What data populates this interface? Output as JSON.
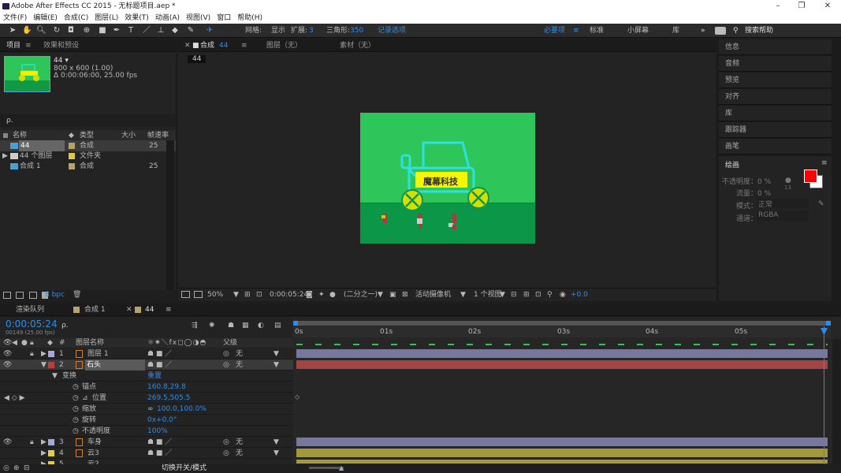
{
  "window": {
    "title": "Adobe After Effects CC 2015 - 无标题项目.aep *",
    "min": "–",
    "max": "❐",
    "close": "✕"
  },
  "menu": [
    "文件(F)",
    "编辑(E)",
    "合成(C)",
    "图层(L)",
    "效果(T)",
    "动画(A)",
    "视图(V)",
    "窗口",
    "帮助(H)"
  ],
  "toolbar": {
    "grid": "网格:",
    "show": "显示",
    "expand": "扩展:",
    "expand_val": "3",
    "triangles": "三角形:",
    "triangles_val": "350",
    "record": "记录选项",
    "workspaces": [
      "必要项",
      "标准",
      "小屏幕",
      "库"
    ],
    "more": "»",
    "search": "搜索帮助"
  },
  "project": {
    "tab": "项目",
    "tab_menu": "≡",
    "effects_tab": "效果和预设",
    "comp_name": "44 ▾",
    "comp_size": "800 x 600 (1.00)",
    "comp_dur": "Δ 0:00:06:00, 25.00 fps",
    "search_placeholder": "ρ.",
    "cols": [
      "名称",
      "类型",
      "大小",
      "帧速率"
    ],
    "items": [
      {
        "name": "44",
        "type": "合成",
        "size": "",
        "fps": "25",
        "color": "#b8a26b"
      },
      {
        "name": "44 个图层",
        "type": "文件夹",
        "size": "",
        "fps": "",
        "color": "#e0c74a"
      },
      {
        "name": "合成 1",
        "type": "合成",
        "size": "",
        "fps": "25",
        "color": "#b8a26b"
      }
    ],
    "bpc": "8 bpc"
  },
  "viewer": {
    "tabs": [
      "合成",
      "图层（无）",
      "素材（无）"
    ],
    "comp_tab_name": "44",
    "comp_label": "44",
    "zoom": "50%",
    "time": "0:00:05:24",
    "res": "(二分之一)",
    "camera": "活动摄像机",
    "views": "1 个视图",
    "exposure": "+0.0",
    "car_sign": "魔幕科技"
  },
  "right": {
    "panels": [
      "信息",
      "音频",
      "预览",
      "对齐",
      "库",
      "跟踪器",
      "画笔"
    ],
    "paint": {
      "title": "绘画",
      "opacity": "不透明度：0 %",
      "flow": "流量：0 %",
      "mode_label": "模式：",
      "mode": "正常",
      "channel_label": "通道：",
      "channel": "RGBA",
      "brush_size": "13",
      "fg": "#ff0000",
      "bg": "#ffffff"
    }
  },
  "timeline": {
    "tabs": [
      "渲染队列",
      "合成 1",
      "44"
    ],
    "time": "0:00:05:24",
    "frames": "00149 (25.00 fps)",
    "search_placeholder": "ρ.",
    "col_name": "图层名称",
    "col_parent": "父级",
    "ruler": [
      "0s",
      "01s",
      "02s",
      "03s",
      "04s",
      "05s"
    ],
    "layers": [
      {
        "num": "1",
        "name": "图层 1",
        "color": "#a8a8d8",
        "parent": "无",
        "barcolor": "#7777a0"
      },
      {
        "num": "2",
        "name": "石头",
        "color": "#c23a3a",
        "parent": "无",
        "barcolor": "#a34545",
        "selected": true
      },
      {
        "num": "3",
        "name": "车身",
        "color": "#a8a8d8",
        "parent": "无",
        "barcolor": "#7777a0"
      },
      {
        "num": "4",
        "name": "云3",
        "color": "#e0d040",
        "parent": "无",
        "barcolor": "#a29a3a"
      },
      {
        "num": "5",
        "name": "云2",
        "color": "#e0d040",
        "parent": "无",
        "barcolor": "#a29a3a"
      }
    ],
    "transform": {
      "label": "变换",
      "reset": "重置",
      "props": [
        {
          "name": "锚点",
          "value": "160.8,29.8"
        },
        {
          "name": "位置",
          "value": "269.5,505.5"
        },
        {
          "name": "缩放",
          "value": "100.0,100.0%"
        },
        {
          "name": "旋转",
          "value": "0x+0.0°"
        },
        {
          "name": "不透明度",
          "value": "100%"
        }
      ]
    },
    "footer": "切换开关/模式"
  }
}
